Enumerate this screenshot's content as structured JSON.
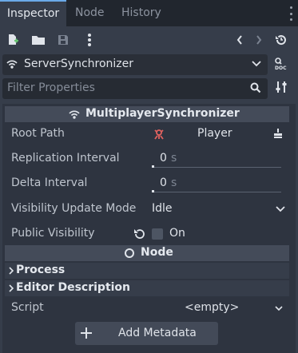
{
  "tabs": [
    {
      "label": "Inspector"
    },
    {
      "label": "Node"
    },
    {
      "label": "History"
    }
  ],
  "node_selector": {
    "value": "ServerSynchronizer"
  },
  "filter": {
    "placeholder": "Filter Properties"
  },
  "section": {
    "title": "MultiplayerSynchronizer"
  },
  "properties": {
    "root_path": {
      "label": "Root Path",
      "value": "Player"
    },
    "replication_interval": {
      "label": "Replication Interval",
      "value": "0",
      "unit": "s"
    },
    "delta_interval": {
      "label": "Delta Interval",
      "value": "0",
      "unit": "s"
    },
    "visibility_update_mode": {
      "label": "Visibility Update Mode",
      "value": "Idle"
    },
    "public_visibility": {
      "label": "Public Visibility",
      "value": "On"
    }
  },
  "node_section": {
    "title": "Node"
  },
  "groups": {
    "process": "Process",
    "editor_description": "Editor Description"
  },
  "script": {
    "label": "Script",
    "value": "<empty>"
  },
  "add_metadata": {
    "label": "Add Metadata"
  },
  "colors": {
    "accent": "#6aa9e8",
    "node_icon_red": "#e0625f",
    "background": "#363d4a"
  }
}
